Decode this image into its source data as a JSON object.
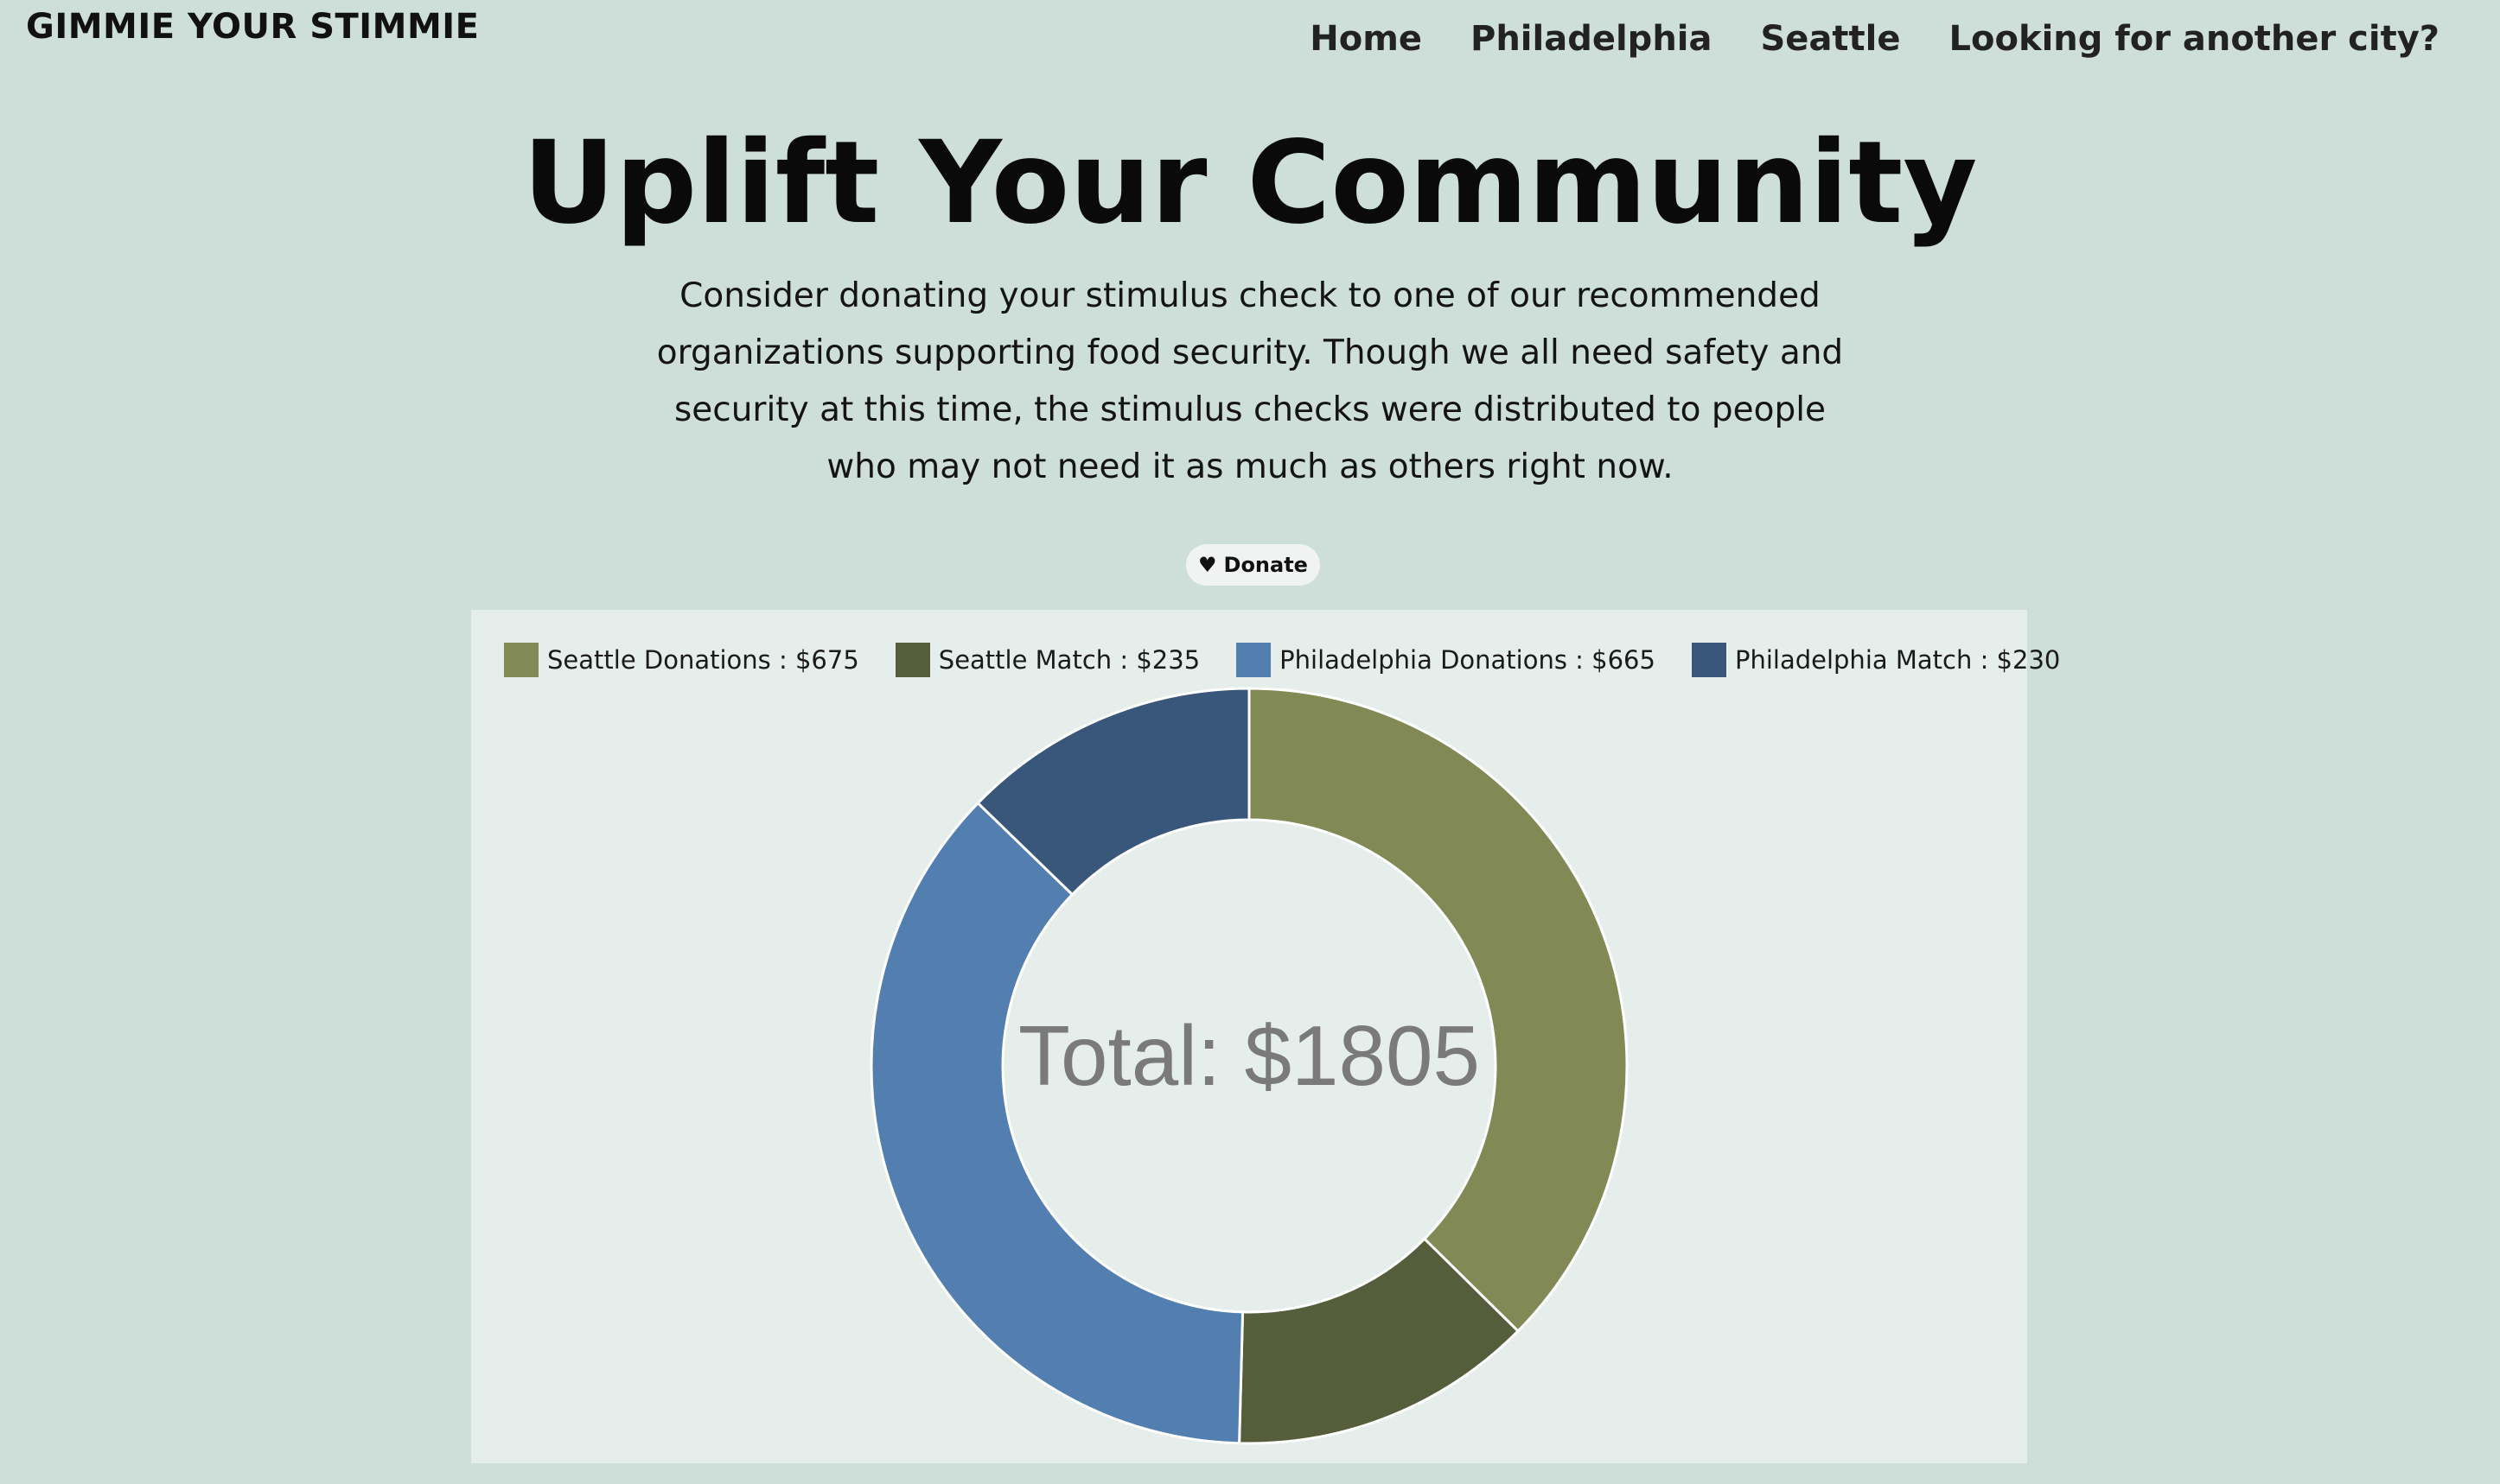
{
  "header": {
    "brand": "GIMMIE YOUR STIMMIE",
    "nav": [
      "Home",
      "Philadelphia",
      "Seattle",
      "Looking for another city?"
    ]
  },
  "hero": {
    "title": "Uplift Your Community",
    "description": "Consider donating your stimulus check to one of our recommended organizations supporting food security. Though we all need safety and security at this time, the stimulus checks were distributed to people who may not need it as much as others right now."
  },
  "donate": {
    "icon": "heart-icon",
    "label": "Donate"
  },
  "chart_data": {
    "type": "pie",
    "center_label": "Total: $1805",
    "series": [
      {
        "name": "Seattle Donations",
        "label": "Seattle Donations : $675",
        "value": 675,
        "color": "#818a55"
      },
      {
        "name": "Seattle Match",
        "label": "Seattle Match : $235",
        "value": 235,
        "color": "#565d3a"
      },
      {
        "name": "Philadelphia Donations",
        "label": "Philadelphia Donations : $665",
        "value": 665,
        "color": "#537eb0"
      },
      {
        "name": "Philadelphia Match",
        "label": "Philadelphia Match : $230",
        "value": 230,
        "color": "#39577a"
      }
    ],
    "legend": "top-left"
  }
}
